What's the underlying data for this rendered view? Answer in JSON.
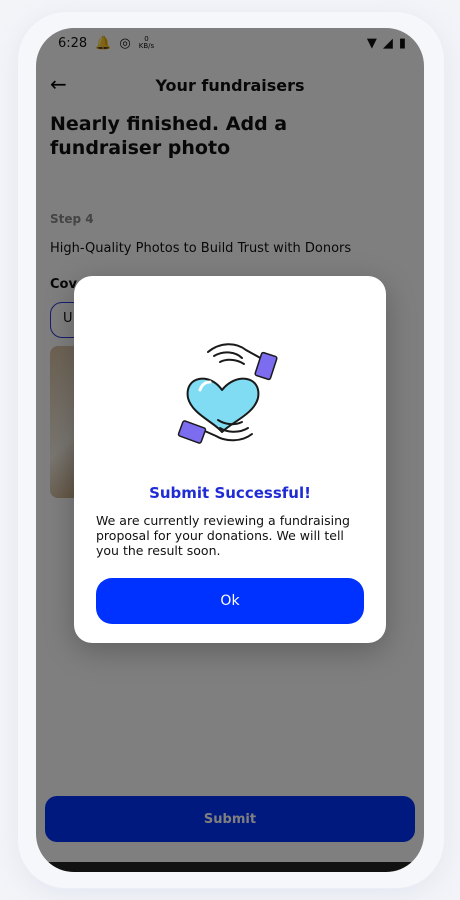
{
  "status_bar": {
    "time": "6:28",
    "data_rate_value": "0",
    "data_rate_unit": "KB/s"
  },
  "header": {
    "title": "Your fundraisers"
  },
  "headline": "Nearly finished. Add a fundraiser photo",
  "step": {
    "label": "Step 4",
    "description": "High-Quality Photos to Build Trust with Donors",
    "cover_label": "Cov",
    "upload_label": "U"
  },
  "submit_label": "Submit",
  "dialog": {
    "title": "Submit Successful!",
    "message": "We are currently reviewing a fundraising proposal for your donations. We will tell you the result soon.",
    "ok_label": "Ok"
  },
  "colors": {
    "primary": "#0032ff",
    "title_blue": "#1f2bd4",
    "heart": "#7fdcf2",
    "cuff": "#7c6cf0"
  }
}
